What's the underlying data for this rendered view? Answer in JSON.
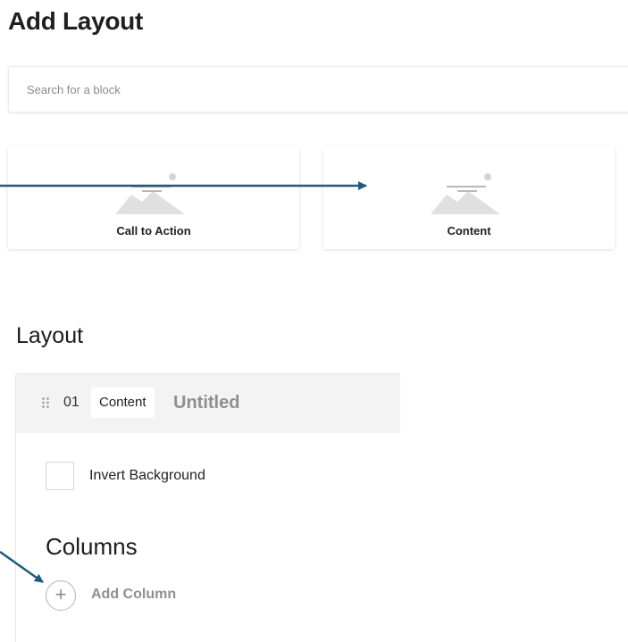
{
  "page": {
    "title": "Add Layout"
  },
  "search": {
    "placeholder": "Search for a block"
  },
  "blocks": [
    {
      "label": "Call to Action"
    },
    {
      "label": "Content"
    }
  ],
  "layout": {
    "section_title": "Layout",
    "row": {
      "number": "01",
      "type_chip": "Content",
      "title": "Untitled",
      "invert_background_label": "Invert Background",
      "columns_heading": "Columns",
      "add_column_label": "Add Column",
      "add_column_glyph": "+"
    }
  },
  "colors": {
    "accent_arrow": "#215a7a",
    "placeholder_text": "#8a8a8a",
    "header_bg": "#f3f3f3",
    "muted_text": "#8f8f8f"
  }
}
